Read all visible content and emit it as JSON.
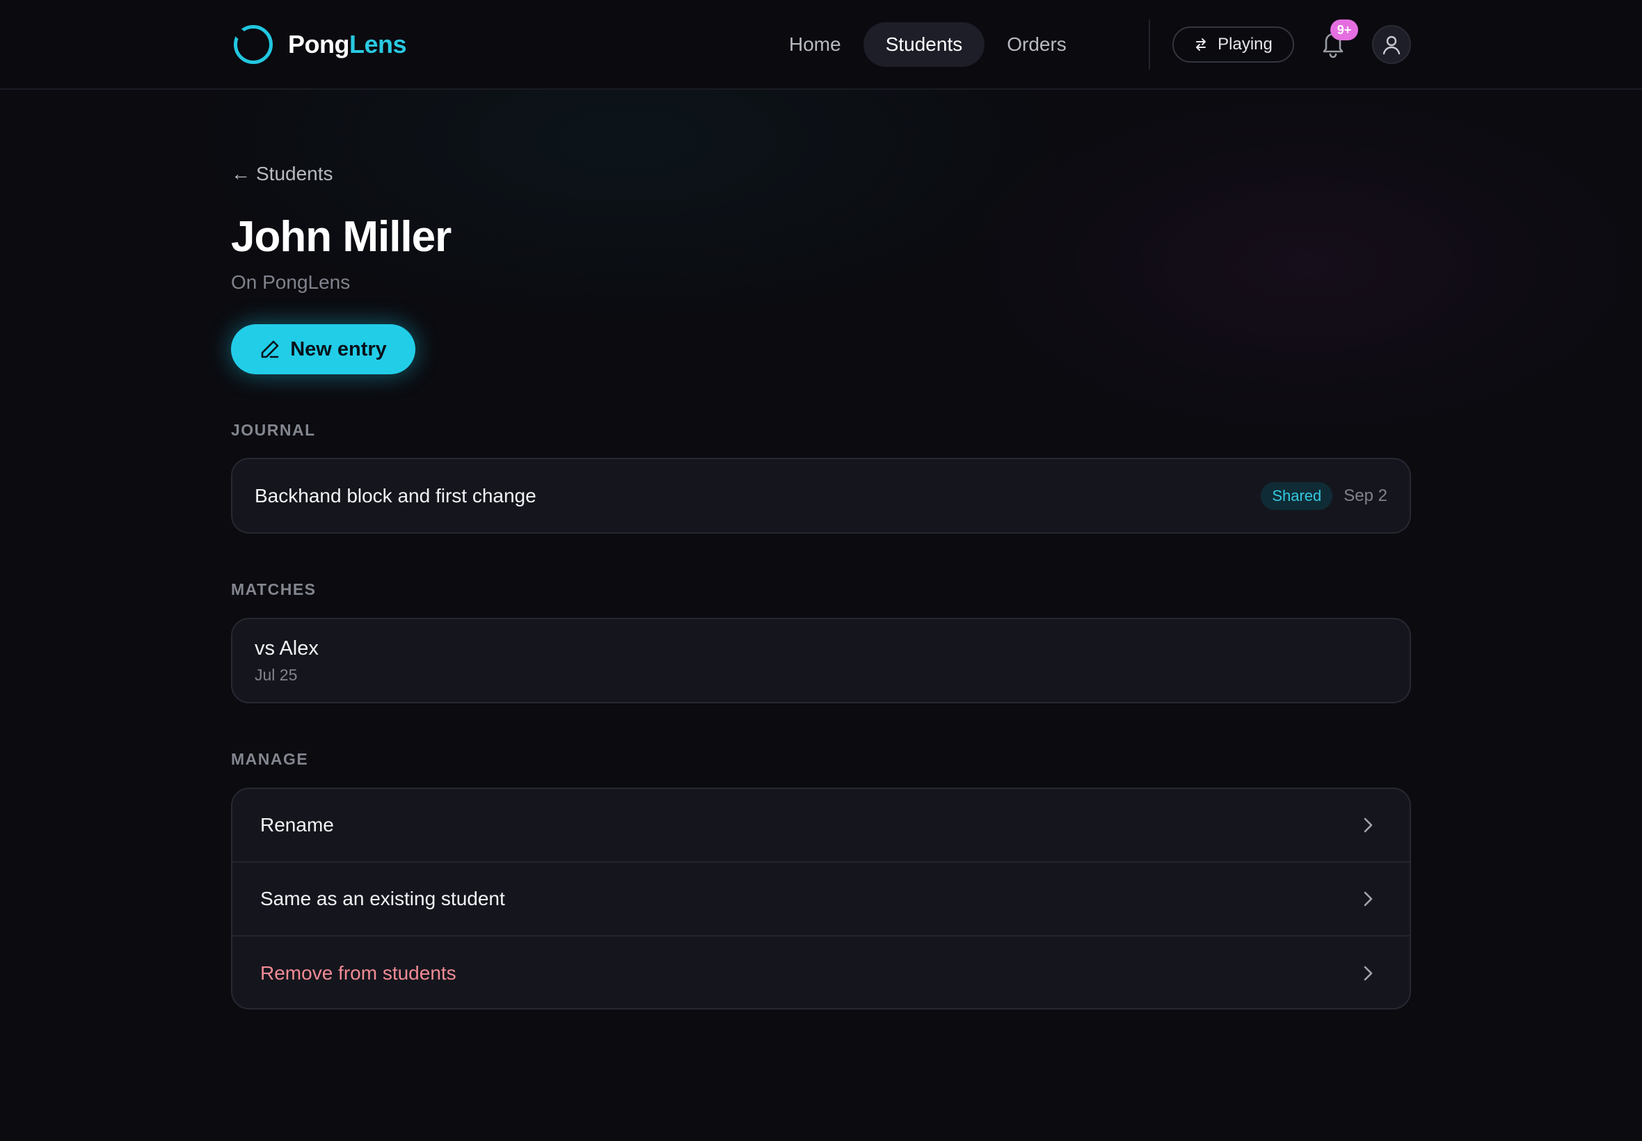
{
  "app": {
    "name_part1": "Pong",
    "name_part2": "Lens",
    "accent": "#22cde8"
  },
  "nav": {
    "items": [
      {
        "label": "Home",
        "active": false
      },
      {
        "label": "Students",
        "active": true
      },
      {
        "label": "Orders",
        "active": false
      }
    ]
  },
  "header": {
    "playing_label": "Playing",
    "notification_badge": "9+"
  },
  "page": {
    "back_label": "Students",
    "title": "John Miller",
    "subtitle": "On PongLens",
    "new_entry_label": "New entry"
  },
  "journal": {
    "section_label": "JOURNAL",
    "entries": [
      {
        "title": "Backhand block and first change",
        "status": "Shared",
        "date": "Sep 2"
      }
    ]
  },
  "matches": {
    "section_label": "MATCHES",
    "items": [
      {
        "title": "vs Alex",
        "date": "Jul 25"
      }
    ]
  },
  "manage": {
    "section_label": "MANAGE",
    "items": [
      {
        "label": "Rename"
      },
      {
        "label": "Same as an existing student"
      },
      {
        "label": "Remove from students",
        "danger_color": "#f28b95"
      }
    ]
  }
}
